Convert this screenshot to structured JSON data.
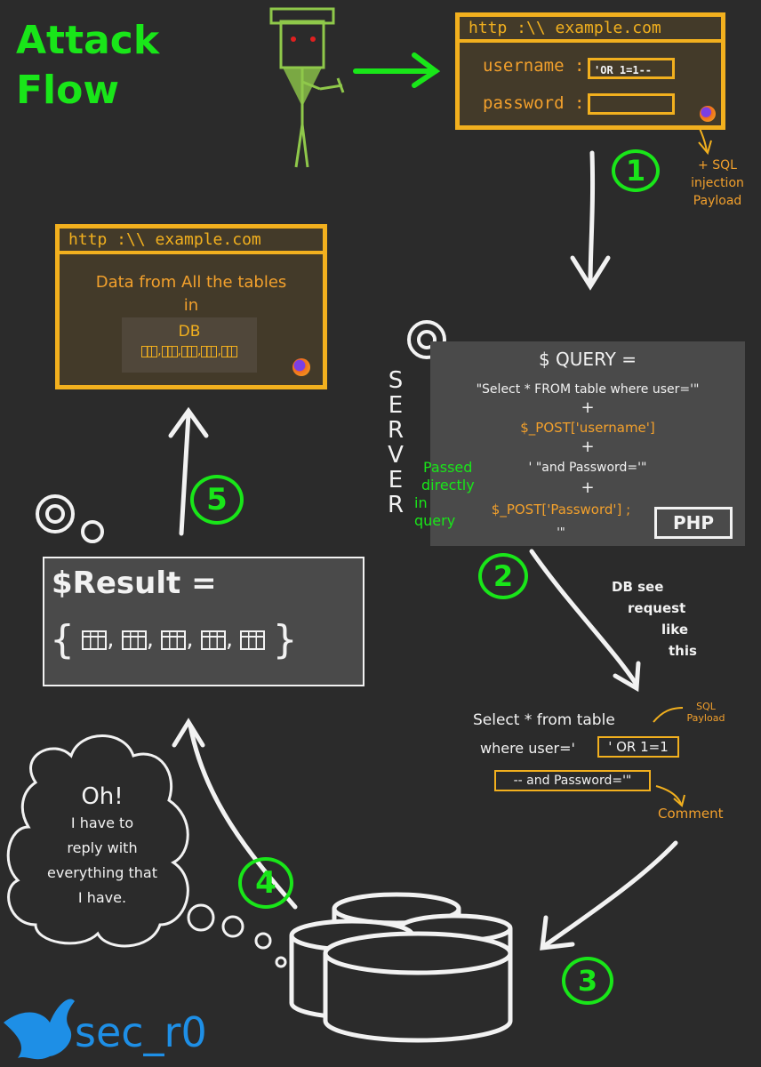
{
  "title": [
    "Attack",
    "Flow"
  ],
  "login_browser": {
    "url": "http :\\\\ example.com",
    "username_label": "username :",
    "username_value": "'OR 1=1--",
    "password_label": "password :"
  },
  "payload_note": "+ SQL injection Payload",
  "result_browser": {
    "url": "http :\\\\ example.com",
    "line1": "Data from All the tables",
    "line2": "in",
    "db_label": "DB"
  },
  "server_label": [
    "S",
    "E",
    "R",
    "V",
    "E",
    "R"
  ],
  "query": {
    "title": "$ QUERY =",
    "line1": "\"Select * FROM table where user='\"",
    "plus": "+",
    "line2": "$_POST['username']",
    "line3": "' \"and Password='\"",
    "line4": "$_POST['Password'] ;",
    "line5": "'\"",
    "badge": "PHP"
  },
  "passed_note": [
    "Passed",
    "directly",
    "in",
    "query"
  ],
  "db_note": [
    "DB see",
    "request",
    "like",
    "this"
  ],
  "db_query": {
    "line1": "Select * from table",
    "line2_prefix": "where user='",
    "payload": "' OR 1=1",
    "comment_part": "-- and Password='\"",
    "sql_payload_label": "SQL Payload",
    "comment_label": "Comment"
  },
  "result": {
    "label": "$Result =",
    "open_brace": "{",
    "close_brace": "}"
  },
  "thought": [
    "Oh!",
    "I have to",
    "reply with",
    "everything that",
    "I have."
  ],
  "steps": [
    "1",
    "2",
    "3",
    "4",
    "5"
  ],
  "brand": "sec_r0",
  "colors": {
    "green": "#19e619",
    "orange": "#f2b01e",
    "background": "#2b2b2b"
  }
}
